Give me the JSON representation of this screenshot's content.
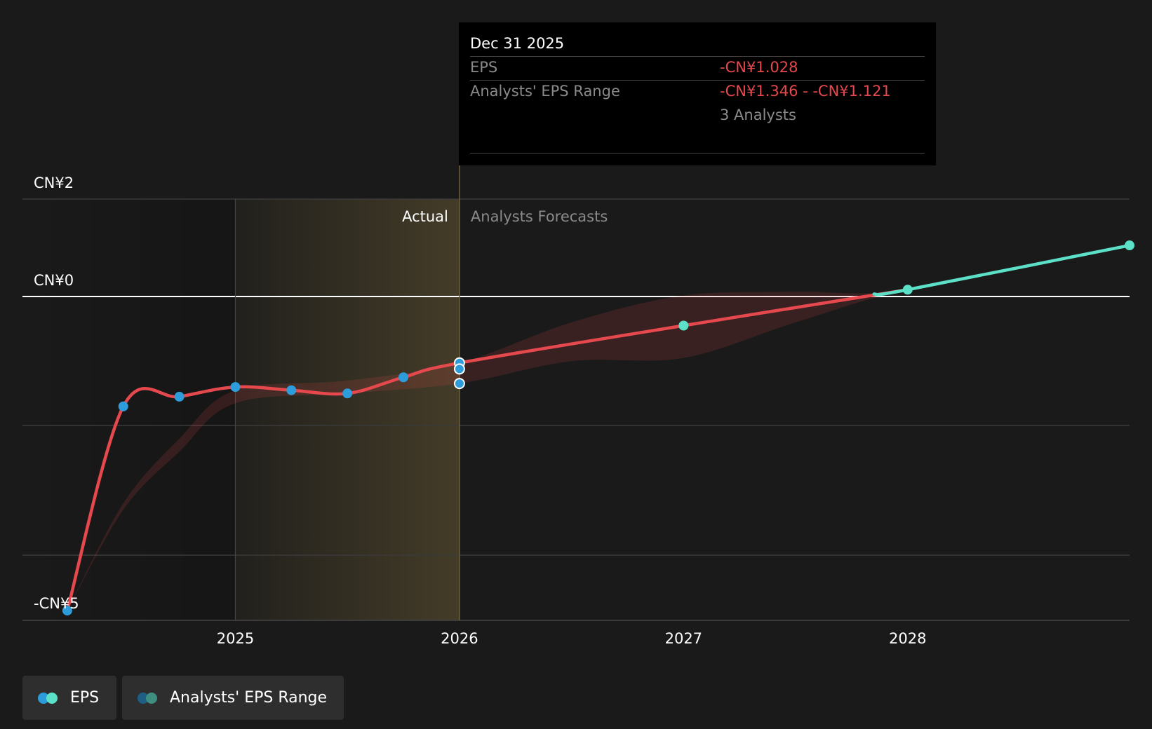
{
  "chart_data": {
    "type": "line",
    "y_ticks": [
      {
        "value": 2,
        "label": "CN¥2"
      },
      {
        "value": 0,
        "label": "CN¥0"
      },
      {
        "value": -5,
        "label": "-CN¥5"
      }
    ],
    "ylim": [
      -5,
      2
    ],
    "x_ticks": [
      {
        "value": 2025.0,
        "label": "2025"
      },
      {
        "value": 2026.0,
        "label": "2026"
      },
      {
        "value": 2027.0,
        "label": "2027"
      },
      {
        "value": 2028.0,
        "label": "2028"
      }
    ],
    "xlim": [
      2024.05,
      2028.99
    ],
    "grid": true,
    "actual_label": "Actual",
    "forecast_label": "Analysts Forecasts",
    "divider_x": 2026.0,
    "series": [
      {
        "name": "EPS",
        "color": "#e5484d",
        "values": [
          {
            "x": 2024.25,
            "y": -4.86
          },
          {
            "x": 2024.5,
            "y": -1.7
          },
          {
            "x": 2024.75,
            "y": -1.55
          },
          {
            "x": 2025.0,
            "y": -1.4
          },
          {
            "x": 2025.25,
            "y": -1.45
          },
          {
            "x": 2025.5,
            "y": -1.5
          },
          {
            "x": 2025.75,
            "y": -1.25
          },
          {
            "x": 2026.0,
            "y": -1.028
          },
          {
            "x": 2027.0,
            "y": -0.45
          },
          {
            "x": 2028.0,
            "y": 0.14
          },
          {
            "x": 2028.99,
            "y": 1.05
          }
        ],
        "forecast_color": "#5ce1c8"
      }
    ],
    "extra_points": [
      {
        "x": 2026.0,
        "y": -1.121
      },
      {
        "x": 2026.0,
        "y": -1.346
      }
    ],
    "range_band": {
      "name": "Analysts' EPS Range",
      "color": "#e5484d",
      "upper": [
        {
          "x": 2024.25,
          "y": -4.86
        },
        {
          "x": 2024.5,
          "y": -3.2
        },
        {
          "x": 2024.75,
          "y": -2.2
        },
        {
          "x": 2025.0,
          "y": -1.45
        },
        {
          "x": 2025.5,
          "y": -1.3
        },
        {
          "x": 2026.0,
          "y": -1.028
        },
        {
          "x": 2026.5,
          "y": -0.4
        },
        {
          "x": 2027.0,
          "y": 0.02
        },
        {
          "x": 2027.5,
          "y": 0.1
        },
        {
          "x": 2028.0,
          "y": 0.14
        },
        {
          "x": 2028.99,
          "y": 1.05
        }
      ],
      "lower": [
        {
          "x": 2024.25,
          "y": -4.86
        },
        {
          "x": 2024.5,
          "y": -3.3
        },
        {
          "x": 2024.75,
          "y": -2.4
        },
        {
          "x": 2025.0,
          "y": -1.65
        },
        {
          "x": 2025.5,
          "y": -1.5
        },
        {
          "x": 2026.0,
          "y": -1.346
        },
        {
          "x": 2026.5,
          "y": -1.0
        },
        {
          "x": 2027.0,
          "y": -0.95
        },
        {
          "x": 2027.5,
          "y": -0.4
        },
        {
          "x": 2028.0,
          "y": 0.14
        },
        {
          "x": 2028.99,
          "y": 1.05
        }
      ]
    },
    "tooltip": {
      "date": "Dec 31 2025",
      "eps_label": "EPS",
      "eps_value": "-CN¥1.028",
      "range_label": "Analysts' EPS Range",
      "range_value": "-CN¥1.346 - -CN¥1.121",
      "analysts": "3 Analysts"
    },
    "legend": [
      {
        "label": "EPS",
        "colors": [
          "#2d9cdb",
          "#5ce1c8"
        ]
      },
      {
        "label": "Analysts' EPS Range",
        "colors": [
          "#1f5f86",
          "#3f8f80"
        ]
      }
    ],
    "colors": {
      "background": "#1a1a1a",
      "actual_dot": "#2d9cdb",
      "forecast_dot": "#5ce1c8",
      "line_actual": "#e5484d",
      "line_forecast": "#5ce1c8",
      "actual_shade": "#d7b45a"
    }
  }
}
